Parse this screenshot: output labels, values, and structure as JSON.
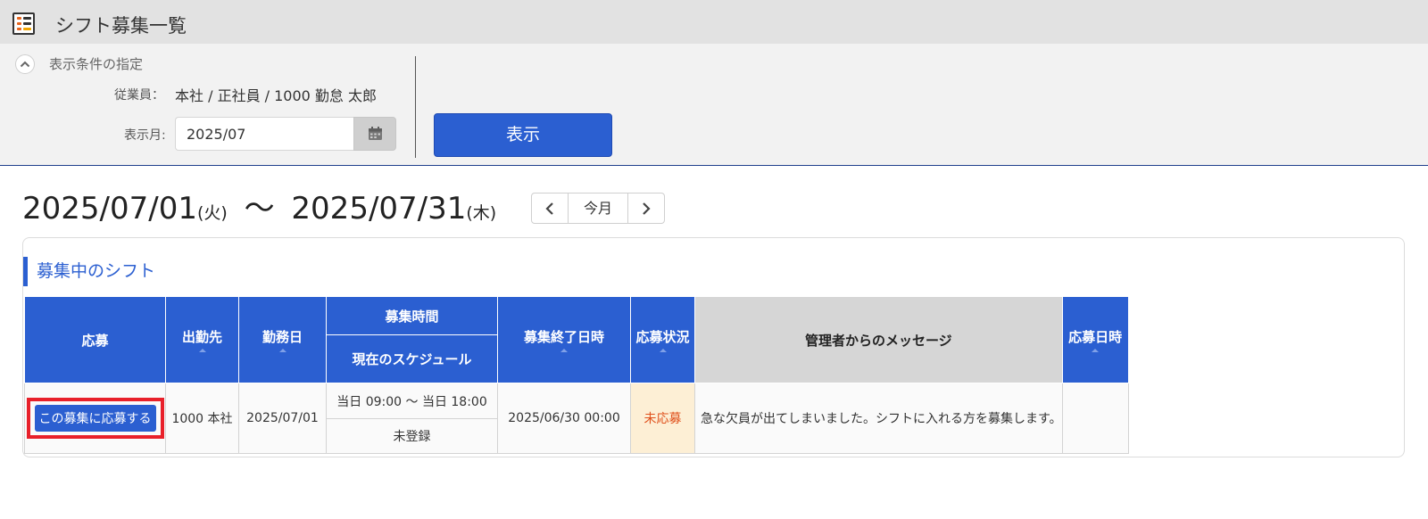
{
  "header": {
    "title": "シフト募集一覧",
    "icon": "list-app-icon"
  },
  "filter": {
    "section_title": "表示条件の指定",
    "employee_label": "従業員：",
    "employee_value": "本社 / 正社員 / 1000 勤怠 太郎",
    "month_label": "表示月:",
    "month_value": "2025/07",
    "show_button": "表示"
  },
  "range": {
    "start": "2025/07/01",
    "start_day": "(火)",
    "tilde": "〜",
    "end": "2025/07/31",
    "end_day": "(木)",
    "today_label": "今月"
  },
  "panel": {
    "title": "募集中のシフト",
    "columns": {
      "apply": "応募",
      "location": "出勤先",
      "work_date": "勤務日",
      "recruit_time": "募集時間",
      "current_schedule": "現在のスケジュール",
      "recruit_end": "募集終了日時",
      "status": "応募状況",
      "message": "管理者からのメッセージ",
      "applied_at": "応募日時"
    },
    "rows": [
      {
        "apply_button": "この募集に応募する",
        "location": "1000 本社",
        "work_date": "2025/07/01",
        "recruit_time": "当日 09:00 〜 当日 18:00",
        "current_schedule": "未登録",
        "recruit_end": "2025/06/30 00:00",
        "status": "未応募",
        "message": "急な欠員が出てしまいました。シフトに入れる方を募集します。",
        "applied_at": ""
      }
    ]
  },
  "colors": {
    "accent": "#2b5fd1",
    "highlight": "#e8202a",
    "status_text": "#e0501c",
    "status_bg": "#fdefd5"
  }
}
